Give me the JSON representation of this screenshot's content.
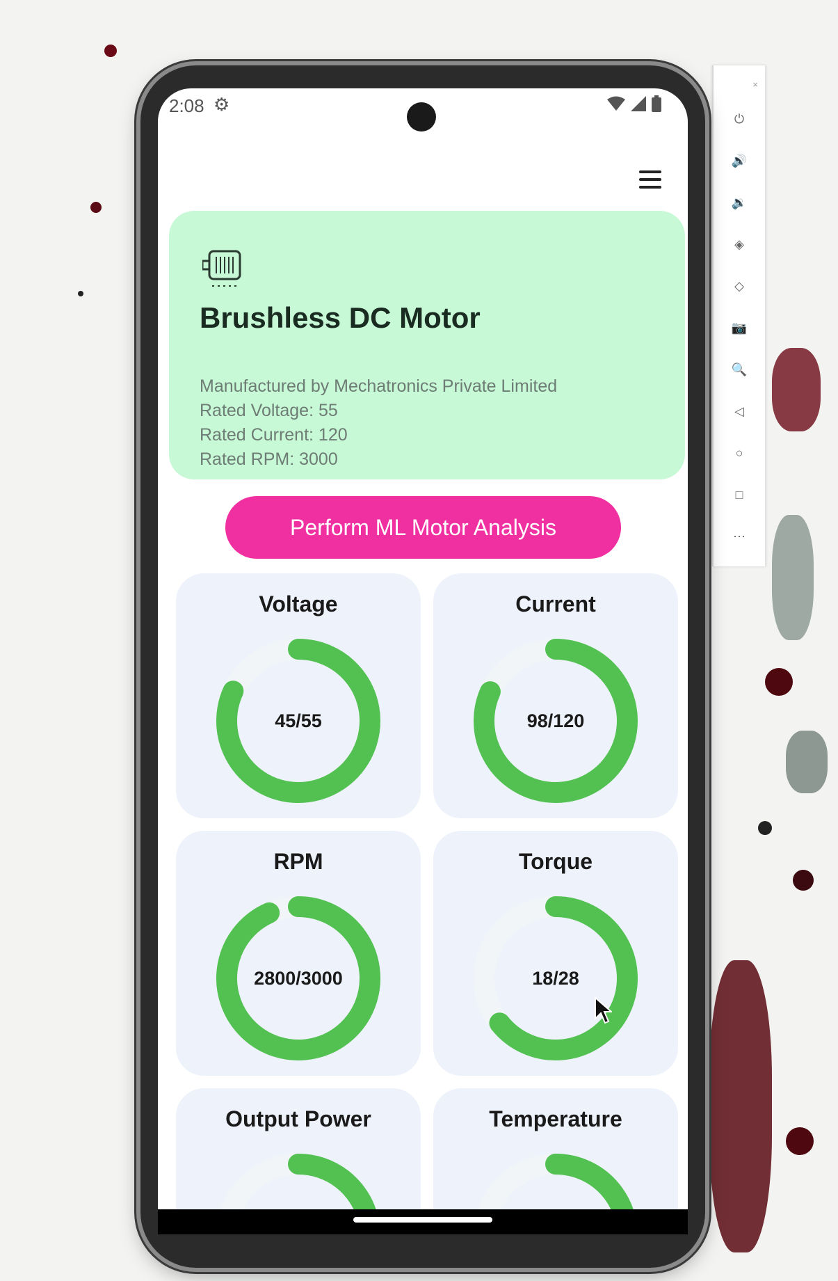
{
  "status": {
    "time": "2:08"
  },
  "card": {
    "title": "Brushless DC Motor",
    "manufacturer": "Manufactured by Mechatronics Private Limited",
    "rated_voltage": "Rated Voltage: 55",
    "rated_current": "Rated Current: 120",
    "rated_rpm": "Rated RPM: 3000"
  },
  "action_button": {
    "label": "Perform ML Motor Analysis"
  },
  "gauges": [
    {
      "title": "Voltage",
      "value": 45,
      "max": 55,
      "label": "45/55"
    },
    {
      "title": "Current",
      "value": 98,
      "max": 120,
      "label": "98/120"
    },
    {
      "title": "RPM",
      "value": 2800,
      "max": 3000,
      "label": "2800/3000"
    },
    {
      "title": "Torque",
      "value": 18,
      "max": 28,
      "label": "18/28"
    },
    {
      "title": "Output Power",
      "value": null,
      "max": null,
      "label": ""
    },
    {
      "title": "Temperature",
      "value": null,
      "max": null,
      "label": ""
    }
  ],
  "colors": {
    "accent_button": "#f02fa0",
    "card_background": "#c8f9d6",
    "gauge_fill": "#52c152",
    "gauge_track": "#f2f5f8"
  },
  "icons": {
    "settings": "gear-icon",
    "wifi": "wifi-icon",
    "signal": "signal-icon",
    "battery": "battery-icon",
    "menu": "hamburger-menu-icon",
    "motor": "motor-icon"
  }
}
